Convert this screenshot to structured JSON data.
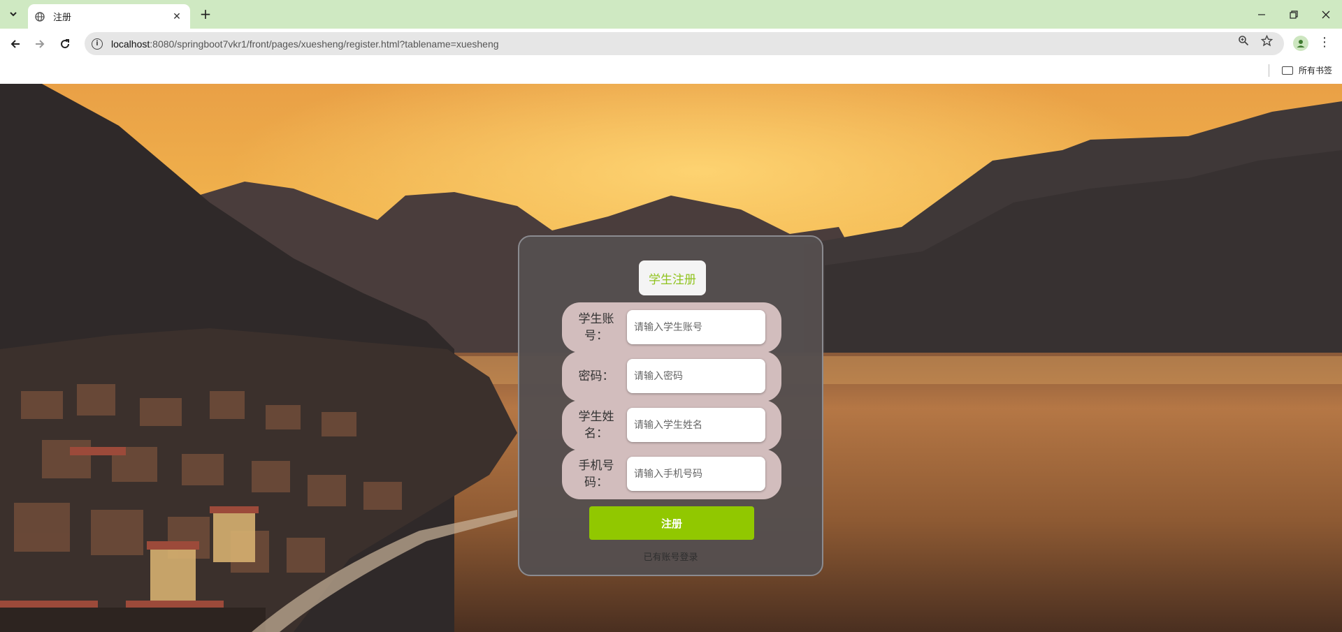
{
  "browser": {
    "tab_title": "注册",
    "url_host": "localhost",
    "url_rest": ":8080/springboot7vkr1/front/pages/xuesheng/register.html?tablename=xuesheng",
    "bookmarks_all": "所有书签"
  },
  "form": {
    "title": "学生注册",
    "fields": [
      {
        "label": "学生账号：",
        "placeholder": "请输入学生账号"
      },
      {
        "label": "密码：",
        "placeholder": "请输入密码"
      },
      {
        "label": "学生姓名：",
        "placeholder": "请输入学生姓名"
      },
      {
        "label": "手机号码：",
        "placeholder": "请输入手机号码"
      }
    ],
    "submit_label": "注册",
    "login_link": "已有账号登录"
  },
  "colors": {
    "title_text": "#90c31f",
    "submit_bg": "#91c800",
    "card_bg": "#554e4e",
    "field_bg": "#d2bdbd",
    "tabbar_bg": "#cfe9c2"
  },
  "icons": {
    "tab_favicon": "globe-icon",
    "back": "arrow-left-icon",
    "forward": "arrow-right-icon",
    "reload": "reload-icon",
    "site_info": "info-icon",
    "zoom": "zoom-icon",
    "bookmark": "star-icon",
    "profile": "avatar-icon",
    "menu": "kebab-icon",
    "folder": "folder-icon"
  }
}
